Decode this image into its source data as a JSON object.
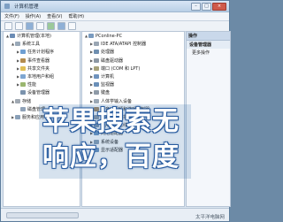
{
  "window": {
    "title": "计算机管理"
  },
  "menu": [
    "文件(F)",
    "操作(A)",
    "查看(V)",
    "帮助(H)"
  ],
  "tree": [
    {
      "label": "计算机管理(本地)",
      "level": 0,
      "exp": "▲",
      "color": "#6b8cb5"
    },
    {
      "label": "系统工具",
      "level": 1,
      "exp": "▲",
      "color": "#9aa9b8"
    },
    {
      "label": "任务计划程序",
      "level": 2,
      "exp": "▶",
      "color": "#6f9fd2"
    },
    {
      "label": "事件查看器",
      "level": 2,
      "exp": "▶",
      "color": "#b38c4f"
    },
    {
      "label": "共享文件夹",
      "level": 2,
      "exp": "▶",
      "color": "#e0bf55"
    },
    {
      "label": "本地用户和组",
      "level": 2,
      "exp": "▶",
      "color": "#7ea6d1"
    },
    {
      "label": "性能",
      "level": 2,
      "exp": "▶",
      "color": "#9ab66f"
    },
    {
      "label": "设备管理器",
      "level": 2,
      "exp": "",
      "color": "#7b93ad"
    },
    {
      "label": "存储",
      "level": 1,
      "exp": "▲",
      "color": "#a0a8b2"
    },
    {
      "label": "磁盘管理",
      "level": 2,
      "exp": "",
      "color": "#8fa2b8"
    },
    {
      "label": "服务和应用程序",
      "level": 1,
      "exp": "▶",
      "color": "#8aa0b8"
    }
  ],
  "devices": [
    {
      "label": "PConline-PC",
      "level": 0,
      "exp": "▲",
      "color": "#7a9bbf"
    },
    {
      "label": "IDE ATA/ATAPI 控制器",
      "level": 1,
      "exp": "▶",
      "color": "#9aa6b3"
    },
    {
      "label": "处理器",
      "level": 1,
      "exp": "▶",
      "color": "#6f8fb0"
    },
    {
      "label": "磁盘驱动器",
      "level": 1,
      "exp": "▶",
      "color": "#8d98a4"
    },
    {
      "label": "端口 (COM 和 LPT)",
      "level": 1,
      "exp": "▶",
      "color": "#a7a27a"
    },
    {
      "label": "计算机",
      "level": 1,
      "exp": "▶",
      "color": "#6f93bd"
    },
    {
      "label": "监视器",
      "level": 1,
      "exp": "▶",
      "color": "#6a8fb8"
    },
    {
      "label": "键盘",
      "level": 1,
      "exp": "▶",
      "color": "#8e9aa7"
    },
    {
      "label": "人体学输入设备",
      "level": 1,
      "exp": "▶",
      "color": "#9aa7b5"
    },
    {
      "label": "声音、视频和游戏控制器",
      "level": 1,
      "exp": "▶",
      "color": "#a48b6b"
    },
    {
      "label": "鼠标和其他指针设备",
      "level": 1,
      "exp": "▶",
      "color": "#8f9caa"
    },
    {
      "label": "通用串行总线控制器",
      "level": 1,
      "exp": "▶",
      "color": "#7f97b0"
    },
    {
      "label": "网络适配器",
      "level": 1,
      "exp": "▶",
      "color": "#6f99c4"
    },
    {
      "label": "系统设备",
      "level": 1,
      "exp": "▶",
      "color": "#8aa1b8"
    },
    {
      "label": "显示适配器",
      "level": 1,
      "exp": "▶",
      "color": "#6e95c0"
    }
  ],
  "actions": {
    "header": "操作",
    "section": "设备管理器",
    "more": "更多操作"
  },
  "overlay": {
    "line1": "苹果搜索无",
    "line2": "响应，百度"
  },
  "watermark": "太平洋电脑网"
}
